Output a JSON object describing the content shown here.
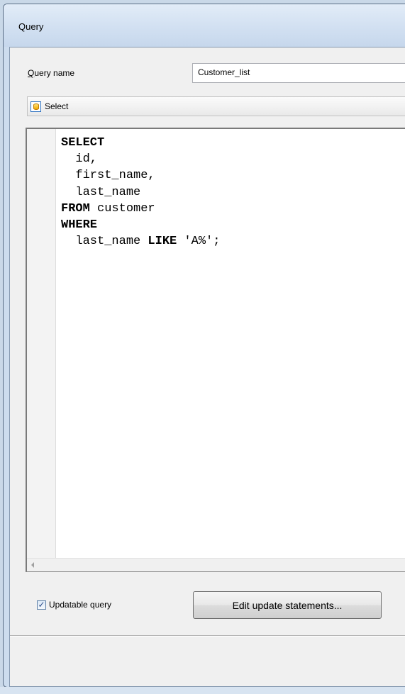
{
  "window": {
    "title": "Query"
  },
  "form": {
    "query_name_label_mnemonic": "Q",
    "query_name_label_rest": "uery name",
    "query_name_value": "Customer_list"
  },
  "toolbar": {
    "select_label": "Select",
    "select_icon": "database-icon"
  },
  "editor": {
    "lines": [
      [
        {
          "text": "SELECT",
          "kw": true
        }
      ],
      [
        {
          "text": "  id,",
          "kw": false
        }
      ],
      [
        {
          "text": "  first_name,",
          "kw": false
        }
      ],
      [
        {
          "text": "  last_name",
          "kw": false
        }
      ],
      [
        {
          "text": "FROM",
          "kw": true
        },
        {
          "text": " customer",
          "kw": false
        }
      ],
      [
        {
          "text": "WHERE",
          "kw": true
        }
      ],
      [
        {
          "text": "  last_name ",
          "kw": false
        },
        {
          "text": "LIKE",
          "kw": true
        },
        {
          "text": " 'A%';",
          "kw": false
        }
      ]
    ]
  },
  "options": {
    "updatable_label": "Updatable query",
    "updatable_checked": true,
    "checkmark": "✓",
    "edit_button_label": "Edit update statements..."
  }
}
